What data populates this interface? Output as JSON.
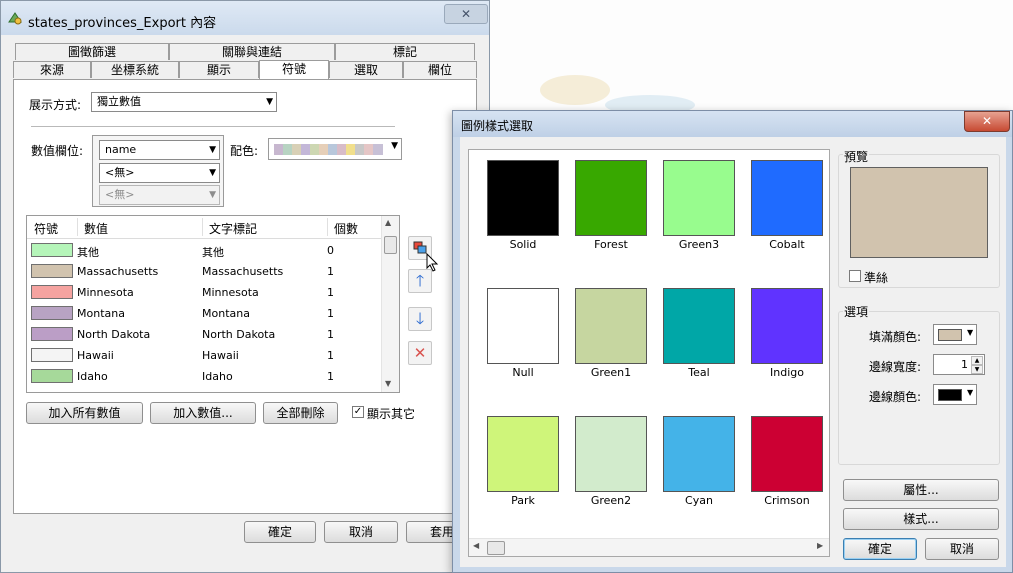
{
  "main_dialog": {
    "title": "states_provinces_Export 內容",
    "close_glyph": "✕",
    "tabs_row1": [
      "圖徵篩選",
      "關聯與連結",
      "標記"
    ],
    "tabs_row2": [
      "來源",
      "坐標系統",
      "顯示",
      "符號",
      "選取",
      "欄位"
    ],
    "active_tab": "符號",
    "display_mode_label": "展示方式:",
    "display_mode_value": "獨立數值",
    "value_field_label": "數值欄位:",
    "value_field_1": "name",
    "value_field_2": "<無>",
    "value_field_3": "<無>",
    "color_ramp_label": "配色:",
    "color_ramp_colors": [
      "#c7b7cf",
      "#b7d3c2",
      "#d8d0b6",
      "#c3b7d8",
      "#cdd7b2",
      "#e6cfb8",
      "#b8c7db",
      "#d8bcc8",
      "#f1df8c",
      "#c8c8c8",
      "#e5c6c6",
      "#c7c0d6"
    ],
    "list_headers": [
      "符號",
      "數值",
      "文字標記",
      "個數"
    ],
    "rows": [
      {
        "color": "#b5f5b9",
        "value": "其他",
        "label": "其他",
        "count": "0"
      },
      {
        "color": "#d1c3ae",
        "value": "Massachusetts",
        "label": "Massachusetts",
        "count": "1"
      },
      {
        "color": "#f5a3a0",
        "value": "Minnesota",
        "label": "Minnesota",
        "count": "1"
      },
      {
        "color": "#b8a3c3",
        "value": "Montana",
        "label": "Montana",
        "count": "1"
      },
      {
        "color": "#bb9ec6",
        "value": "North Dakota",
        "label": "North Dakota",
        "count": "1"
      },
      {
        "color": "#f4f4f4",
        "value": "Hawaii",
        "label": "Hawaii",
        "count": "1"
      },
      {
        "color": "#a6d99a",
        "value": "Idaho",
        "label": "Idaho",
        "count": "1"
      }
    ],
    "add_all_values_label": "加入所有數值",
    "add_value_label": "加入數值...",
    "remove_all_label": "全部刪除",
    "show_others_label": "顯示其它",
    "show_others_checked": true,
    "ok_label": "確定",
    "cancel_label": "取消",
    "apply_label": "套用"
  },
  "style_dialog": {
    "title": "圖例樣式選取",
    "close_glyph": "✕",
    "styles": [
      {
        "name": "Solid",
        "color": "#000000"
      },
      {
        "name": "Forest",
        "color": "#38a800"
      },
      {
        "name": "Green3",
        "color": "#98fc8e"
      },
      {
        "name": "Cobalt",
        "color": "#1f6bff"
      },
      {
        "name": "Null",
        "color": "#ffffff"
      },
      {
        "name": "Green1",
        "color": "#c6d6a0"
      },
      {
        "name": "Teal",
        "color": "#00a7a7"
      },
      {
        "name": "Indigo",
        "color": "#6033ff"
      },
      {
        "name": "Park",
        "color": "#cff57a"
      },
      {
        "name": "Green2",
        "color": "#d2ebcc"
      },
      {
        "name": "Cyan",
        "color": "#44b3e8"
      },
      {
        "name": "Crimson",
        "color": "#cc0033"
      }
    ],
    "preview_label": "預覽",
    "preview_color": "#d1c3ae",
    "hairline_label": "準絲",
    "hairline_checked": false,
    "options_label": "選項",
    "fill_color_label": "填滿顏色:",
    "fill_color": "#d1c3ae",
    "line_width_label": "邊線寬度:",
    "line_width_value": "1",
    "line_color_label": "邊線顏色:",
    "line_color": "#000000",
    "properties_label": "屬性...",
    "styles_label": "樣式...",
    "ok_label": "確定",
    "cancel_label": "取消"
  }
}
